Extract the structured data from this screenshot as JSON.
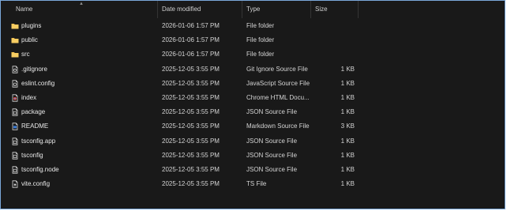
{
  "columns": {
    "name": "Name",
    "date": "Date modified",
    "type": "Type",
    "size": "Size"
  },
  "files": [
    {
      "name": "plugins",
      "date": "2026-01-06 1:57 PM",
      "type": "File folder",
      "size": "",
      "icon": "folder-icon"
    },
    {
      "name": "public",
      "date": "2026-01-06 1:57 PM",
      "type": "File folder",
      "size": "",
      "icon": "folder-icon"
    },
    {
      "name": "src",
      "date": "2026-01-06 1:57 PM",
      "type": "File folder",
      "size": "",
      "icon": "folder-icon"
    },
    {
      "name": ".gitignore",
      "date": "2025-12-05 3:55 PM",
      "type": "Git Ignore Source File",
      "size": "1 KB",
      "icon": "gitignore-file-icon"
    },
    {
      "name": "eslint.config",
      "date": "2025-12-05 3:55 PM",
      "type": "JavaScript Source File",
      "size": "1 KB",
      "icon": "javascript-file-icon"
    },
    {
      "name": "index",
      "date": "2025-12-05 3:55 PM",
      "type": "Chrome HTML Docu...",
      "size": "1 KB",
      "icon": "html-file-icon"
    },
    {
      "name": "package",
      "date": "2025-12-05 3:55 PM",
      "type": "JSON Source File",
      "size": "1 KB",
      "icon": "json-file-icon"
    },
    {
      "name": "README",
      "date": "2025-12-05 3:55 PM",
      "type": "Markdown Source File",
      "size": "3 KB",
      "icon": "markdown-file-icon"
    },
    {
      "name": "tsconfig.app",
      "date": "2025-12-05 3:55 PM",
      "type": "JSON Source File",
      "size": "1 KB",
      "icon": "json-file-icon"
    },
    {
      "name": "tsconfig",
      "date": "2025-12-05 3:55 PM",
      "type": "JSON Source File",
      "size": "1 KB",
      "icon": "json-file-icon"
    },
    {
      "name": "tsconfig.node",
      "date": "2025-12-05 3:55 PM",
      "type": "JSON Source File",
      "size": "1 KB",
      "icon": "json-file-icon"
    },
    {
      "name": "vite.config",
      "date": "2025-12-05 3:55 PM",
      "type": "TS File",
      "size": "1 KB",
      "icon": "typescript-file-icon"
    }
  ],
  "colors": {
    "background": "#191919",
    "folder": "#f2c14e",
    "border_accent": "#7ba7d9"
  }
}
